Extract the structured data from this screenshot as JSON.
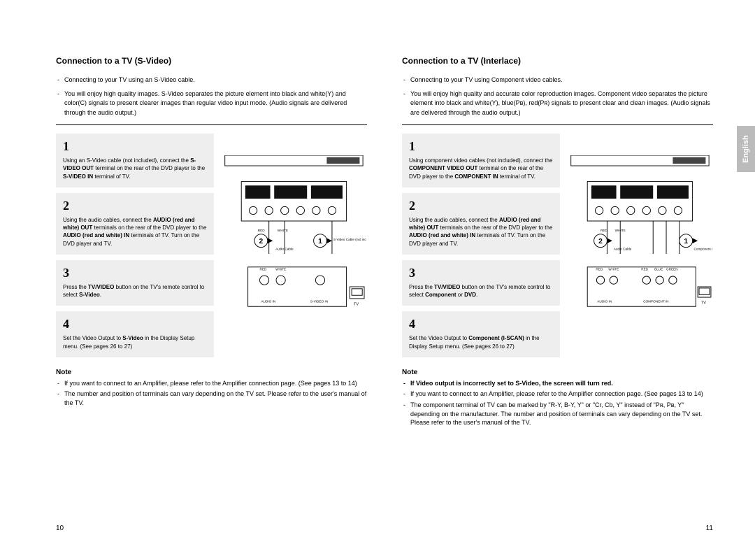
{
  "language_tab": "English",
  "page_numbers": {
    "left": "10",
    "right": "11"
  },
  "left": {
    "heading": "Connection to a TV (S-Video)",
    "intro": [
      "Connecting to your TV using an S-Video cable.",
      "You will enjoy high quality images. S-Video separates the picture element into black and white(Y) and color(C) signals to present clearer images than regular video input mode. (Audio signals are delivered through the audio output.)"
    ],
    "steps": [
      {
        "num": "1",
        "html": "Using an S-Video cable (not included), connect the <b>S-VIDEO OUT</b> terminal on the rear of the DVD player to the <b>S-VIDEO IN</b> terminal of TV."
      },
      {
        "num": "2",
        "html": "Using the audio cables, connect the <b>AUDIO (red and white) OUT</b> terminals on the rear of the DVD player to the <b>AUDIO (red and white) IN</b> terminals of TV. Turn on the DVD player and TV."
      },
      {
        "num": "3",
        "html": "Press the <b>TV/VIDEO</b> button on the TV's remote control to select <b>S-Video</b>."
      },
      {
        "num": "4",
        "html": "Set the Video Output to <b>S-Video</b> in the Display Setup menu. (See pages 26 to 27)"
      }
    ],
    "diagram_labels": {
      "audio_cable": "Audio Cable",
      "svideo_cable": "S-Video Cable (not included)",
      "red": "RED",
      "white": "WHITE",
      "audio_in": "AUDIO IN",
      "svideo_in": "S-VIDEO IN",
      "tv": "TV",
      "markers": {
        "one": "1",
        "two": "2"
      }
    },
    "note_heading": "Note",
    "notes": [
      "If you want to connect to an Amplifier, please refer to the Amplifier connection page. (See pages 13 to 14)",
      "The number and position of terminals can vary depending on the TV set. Please refer to the user's manual of the TV."
    ]
  },
  "right": {
    "heading": "Connection to a TV (Interlace)",
    "intro": [
      "Connecting to your TV using Component video cables.",
      "You will enjoy high quality and accurate color reproduction images. Component video separates the picture element into black and white(Y), blue(Pʙ), red(Pʀ) signals to present clear and clean images. (Audio signals are delivered through the audio output.)"
    ],
    "steps": [
      {
        "num": "1",
        "html": "Using component video cables (not included), connect the <b>COMPONENT VIDEO OUT</b> terminal on the rear of the DVD player to the <b>COMPONENT IN</b> terminal of TV."
      },
      {
        "num": "2",
        "html": "Using the audio cables, connect the <b>AUDIO (red and white) OUT</b> terminals on the rear of the DVD player to the <b>AUDIO (red and white) IN</b> terminals of TV. Turn on the DVD player and TV."
      },
      {
        "num": "3",
        "html": "Press the <b>TV/VIDEO</b> button on the TV's remote control to select <b>Component</b> or <b>DVD</b>."
      },
      {
        "num": "4",
        "html": "Set the Video Output to <b>Component (I-SCAN)</b> in the Display Setup menu. (See pages 26 to 27)"
      }
    ],
    "diagram_labels": {
      "audio_cable": "Audio Cable",
      "component_cable": "Component Cable (not included)",
      "red": "RED",
      "white": "WHITE",
      "blue": "BLUE",
      "green": "GREEN",
      "audio_in": "AUDIO IN",
      "component_in": "COMPONENT IN",
      "tv": "TV",
      "markers": {
        "one": "1",
        "two": "2"
      }
    },
    "note_heading": "Note",
    "notes_warn": "If Video output is incorrectly set to S-Video, the screen will turn red.",
    "notes": [
      "If you want to connect to an Amplifier, please refer to the Amplifier connection page. (See pages 13 to 14)",
      "The component terminal of TV can be marked by \"R-Y, B-Y, Y\" or \"Cr, Cb, Y\" instead of \"Pʀ, Pʙ, Y\" depending on the manufacturer. The number and position of terminals can vary depending on the TV set. Please refer to the user's manual of the TV."
    ]
  }
}
